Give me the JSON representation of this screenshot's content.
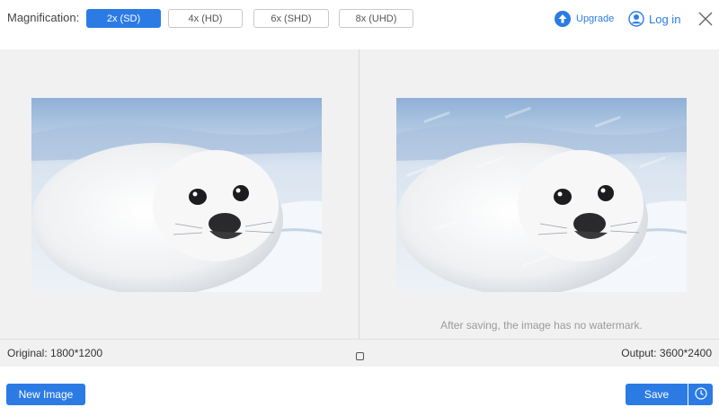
{
  "toolbar": {
    "magnification_label": "Magnification:",
    "options": [
      {
        "label": "2x (SD)",
        "selected": true
      },
      {
        "label": "4x (HD)",
        "selected": false
      },
      {
        "label": "6x (SHD)",
        "selected": false
      },
      {
        "label": "8x (UHD)",
        "selected": false
      }
    ],
    "upgrade_label": "Upgrade",
    "upgrade_icon": "upgrade-arrow-icon",
    "login_label": "Log in",
    "login_icon": "user-icon",
    "close_icon": "close-icon"
  },
  "preview": {
    "original_image": "harp-seal-pup-on-snow",
    "output_image": "harp-seal-pup-on-snow-watermarked",
    "watermark_note": "After saving, the image has no watermark."
  },
  "info": {
    "original_text": "Original: 1800*1200",
    "output_text": "Output: 3600*2400",
    "compare_icon": "square-icon"
  },
  "footer": {
    "new_image_label": "New Image",
    "save_label": "Save",
    "history_icon": "clock-icon"
  },
  "colors": {
    "accent": "#2c7be5",
    "preview_bg": "#f1f1f1"
  }
}
